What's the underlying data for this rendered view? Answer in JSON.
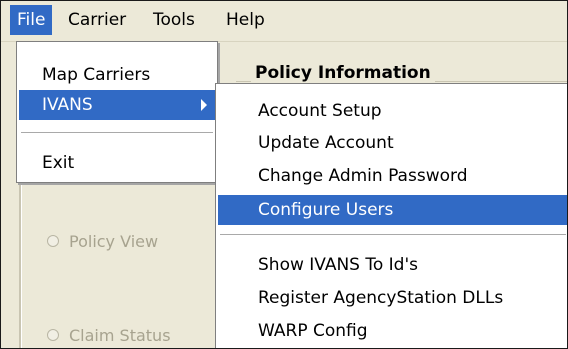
{
  "menubar": {
    "items": [
      {
        "label": "File",
        "active": true
      },
      {
        "label": "Carrier",
        "active": false
      },
      {
        "label": "Tools",
        "active": false
      },
      {
        "label": "Help",
        "active": false
      }
    ]
  },
  "file_menu": {
    "items": [
      {
        "label": "Map Carriers"
      },
      {
        "label": "IVANS",
        "has_submenu": true
      },
      {
        "label": "Exit"
      }
    ]
  },
  "ivans_menu": {
    "items": [
      {
        "label": "Account Setup"
      },
      {
        "label": "Update Account"
      },
      {
        "label": "Change Admin Password"
      },
      {
        "label": "Configure Users",
        "highlighted": true
      },
      {
        "label": "Show IVANS To Id's"
      },
      {
        "label": "Register AgencyStation DLLs"
      },
      {
        "label": "WARP Config"
      }
    ]
  },
  "background": {
    "group_title": "Policy Information",
    "radios": [
      {
        "label": "Policy View"
      },
      {
        "label": "Claim Status"
      }
    ]
  },
  "colors": {
    "highlight": "#316ac5",
    "menu_bg": "#ffffff",
    "window_bg": "#ece9d8",
    "disabled_text": "#a7a38f"
  }
}
